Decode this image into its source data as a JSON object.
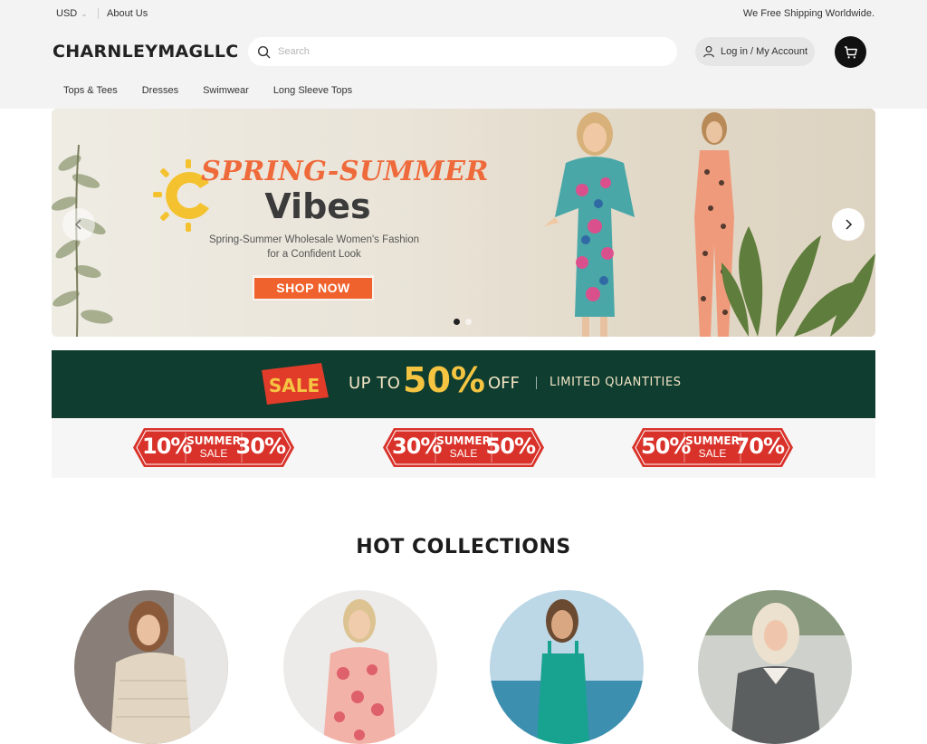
{
  "topbar": {
    "currency": "USD",
    "about": "About Us",
    "shipping": "We Free Shipping Worldwide."
  },
  "header": {
    "logo": "CHARNLEYMAGLLC",
    "search_placeholder": "Search",
    "account_label": "Log in / My Account",
    "icons": [
      "search-icon",
      "user-icon",
      "cart-icon"
    ]
  },
  "nav": {
    "items": [
      "Tops & Tees",
      "Dresses",
      "Swimwear",
      "Long Sleeve Tops"
    ]
  },
  "hero": {
    "kicker": "SPRING-SUMMER",
    "title": "Vibes",
    "subtitle_line1": "Spring-Summer Wholesale Women's Fashion",
    "subtitle_line2": "for a Confident Look",
    "cta": "SHOP NOW",
    "active_slide": 1
  },
  "sale": {
    "badge": "SALE",
    "up_to": "UP TO",
    "percent": "50%",
    "off": "OFF",
    "limited": "LIMITED QUANTITIES",
    "tiers": [
      {
        "from": "10%",
        "line1": "SUMMER",
        "line2": "SALE",
        "to": "30%"
      },
      {
        "from": "30%",
        "line1": "SUMMER",
        "line2": "SALE",
        "to": "50%"
      },
      {
        "from": "50%",
        "line1": "SUMMER",
        "line2": "SALE",
        "to": "70%"
      }
    ]
  },
  "collections": {
    "title": "HOT COLLECTIONS"
  },
  "colors": {
    "brand_dark": "#0f3d30",
    "accent_orange": "#f0622d",
    "gold": "#f5c542",
    "tier_red": "#d9322a"
  }
}
